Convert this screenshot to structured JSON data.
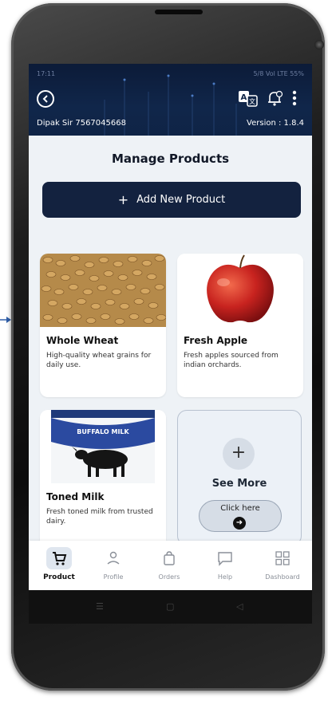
{
  "status_bar": {
    "time": "17:11",
    "indicators": "5/8 Vol LTE 55%"
  },
  "header": {
    "back_icon": "back-circle-icon",
    "translate_icon": "translate-icon",
    "notification_icon": "bell-icon",
    "menu_icon": "more-vert-icon",
    "user": "Dipak Sir 7567045668",
    "version": "Version : 1.8.4"
  },
  "page": {
    "title": "Manage Products",
    "add_button": {
      "icon": "+",
      "label": "Add New Product"
    }
  },
  "products": [
    {
      "name": "Whole Wheat",
      "description": "High-quality wheat grains for daily use."
    },
    {
      "name": "Fresh Apple",
      "description": "Fresh apples sourced from indian orchards."
    },
    {
      "name": "Toned Milk",
      "description": "Fresh toned milk from trusted dairy."
    }
  ],
  "milk_pack_text": "BUFFALO MILK",
  "see_more": {
    "icon": "+",
    "label": "See More",
    "button_label": "Click here",
    "arrow": "➜"
  },
  "bottom_nav": [
    {
      "label": "Product",
      "icon": "cart-icon",
      "active": true
    },
    {
      "label": "Profile",
      "icon": "person-icon",
      "active": false
    },
    {
      "label": "Orders",
      "icon": "bag-icon",
      "active": false
    },
    {
      "label": "Help",
      "icon": "chat-icon",
      "active": false
    },
    {
      "label": "Dashboard",
      "icon": "grid-icon",
      "active": false
    }
  ],
  "system_nav": {
    "menu": "☰",
    "home": "▢",
    "back": "◁"
  },
  "colors": {
    "header_bg": "#0f2446",
    "primary_button": "#13223f",
    "screen_bg": "#eef2f6"
  }
}
